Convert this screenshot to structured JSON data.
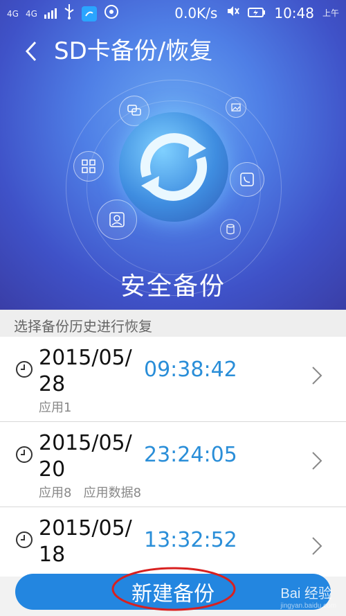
{
  "status_bar": {
    "network_left": "4G",
    "network_right": "4G",
    "speed": "0.0K/s",
    "time": "10:48",
    "am_pm": "上午",
    "icons": [
      "usb-icon",
      "app-icon",
      "vpn-icon",
      "mute-icon",
      "battery-icon"
    ]
  },
  "header": {
    "title": "SD卡备份/恢复"
  },
  "hero": {
    "caption": "安全备份",
    "center_icon": "sync-icon",
    "satellites": [
      "message-icon",
      "image-icon",
      "apps-icon",
      "phone-icon",
      "contacts-icon",
      "database-icon"
    ]
  },
  "list": {
    "header": "选择备份历史进行恢复",
    "items": [
      {
        "date": "2015/05/28",
        "time": "09:38:42",
        "meta": "应用1"
      },
      {
        "date": "2015/05/20",
        "time": "23:24:05",
        "meta": "应用8   应用数据8"
      },
      {
        "date": "2015/05/18",
        "time": "13:32:52",
        "meta": ""
      }
    ]
  },
  "actions": {
    "new_backup": "新建备份"
  },
  "watermark": {
    "text": "Bai 经验",
    "sub": "jingyan.baidu.com"
  },
  "colors": {
    "accent": "#2386e0",
    "time_blue": "#2a8ed8",
    "annotation_red": "#d8201f"
  }
}
